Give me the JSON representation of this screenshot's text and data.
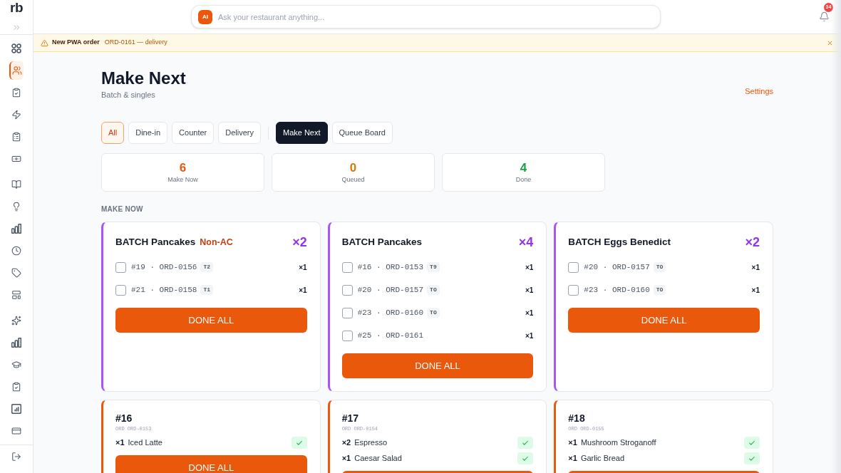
{
  "sidebar": {
    "logo": "rb",
    "groups": [
      {
        "items": [
          {
            "selected": false
          },
          {
            "selected": true
          },
          {
            "selected": false
          },
          {
            "selected": false
          },
          {
            "selected": false
          },
          {
            "selected": false
          }
        ]
      },
      {
        "items": [
          {
            "selected": false
          },
          {
            "selected": false
          },
          {
            "selected": false
          },
          {
            "selected": false
          },
          {
            "selected": false
          },
          {
            "selected": false
          }
        ]
      },
      {
        "items": [
          {
            "selected": false
          },
          {
            "selected": false
          },
          {
            "selected": false
          },
          {
            "selected": false
          },
          {
            "selected": false
          },
          {
            "selected": false
          }
        ]
      }
    ]
  },
  "topbar": {
    "ai_badge": "AI",
    "search": {
      "placeholder": "Ask your restaurant anything..."
    },
    "notifications": {
      "count": "34"
    }
  },
  "banner": {
    "title": "New PWA order",
    "detail": "ORD-0161 — delivery"
  },
  "page": {
    "title": "Make Next",
    "subtitle": "Batch & singles",
    "settings_link": "Settings"
  },
  "filters": [
    {
      "label": "All",
      "selected": true
    },
    {
      "label": "Dine-in",
      "selected": false
    },
    {
      "label": "Counter",
      "selected": false
    },
    {
      "label": "Delivery",
      "selected": false
    }
  ],
  "views": [
    {
      "label": "Make Next",
      "selected": true
    },
    {
      "label": "Queue Board",
      "selected": false
    }
  ],
  "stats": [
    {
      "value": "6",
      "label": "Make Now",
      "color": "#ea580c"
    },
    {
      "value": "0",
      "label": "Queued",
      "color": "#d97706"
    },
    {
      "value": "4",
      "label": "Done",
      "color": "#16a34a"
    }
  ],
  "section_title": "MAKE NOW",
  "batches": [
    {
      "title": "BATCH Pancakes",
      "tag": "Non-AC",
      "quantity": "×2",
      "orders": [
        {
          "label": "#19 · ORD-0156",
          "table": "T2",
          "quantity": "×1",
          "checked": false
        },
        {
          "label": "#21 · ORD-0158",
          "table": "T1",
          "quantity": "×1",
          "checked": false
        }
      ],
      "button": "DONE ALL"
    },
    {
      "title": "BATCH Pancakes",
      "quantity": "×4",
      "orders": [
        {
          "label": "#16 · ORD-0153",
          "table": "T9",
          "quantity": "×1",
          "checked": false
        },
        {
          "label": "#20 · ORD-0157",
          "table": "TO",
          "quantity": "×1",
          "checked": false
        },
        {
          "label": "#23 · ORD-0160",
          "table": "TO",
          "quantity": "×1",
          "checked": false
        },
        {
          "label": "#25 · ORD-0161",
          "quantity": "×1",
          "checked": false
        }
      ],
      "button": "DONE ALL"
    },
    {
      "title": "BATCH Eggs Benedict",
      "quantity": "×2",
      "orders": [
        {
          "label": "#20 · ORD-0157",
          "table": "TO",
          "quantity": "×1",
          "checked": false
        },
        {
          "label": "#23 · ORD-0160",
          "table": "TO",
          "quantity": "×1",
          "checked": false
        }
      ],
      "button": "DONE ALL"
    }
  ],
  "tickets": [
    {
      "number": "#16",
      "order_ref": "ORD ORD-0153",
      "items": [
        {
          "quantity": "×1",
          "name": "Iced Latte",
          "done": true
        }
      ],
      "button": "DONE ALL"
    },
    {
      "number": "#17",
      "order_ref": "ORD ORD-0154",
      "items": [
        {
          "quantity": "×2",
          "name": "Espresso",
          "done": true
        },
        {
          "quantity": "×1",
          "name": "Caesar Salad",
          "done": true
        }
      ]
    },
    {
      "number": "#18",
      "order_ref": "ORD ORD-0155",
      "items": [
        {
          "quantity": "×1",
          "name": "Mushroom Stroganoff",
          "done": true
        },
        {
          "quantity": "×1",
          "name": "Garlic Bread",
          "done": true
        }
      ]
    }
  ]
}
